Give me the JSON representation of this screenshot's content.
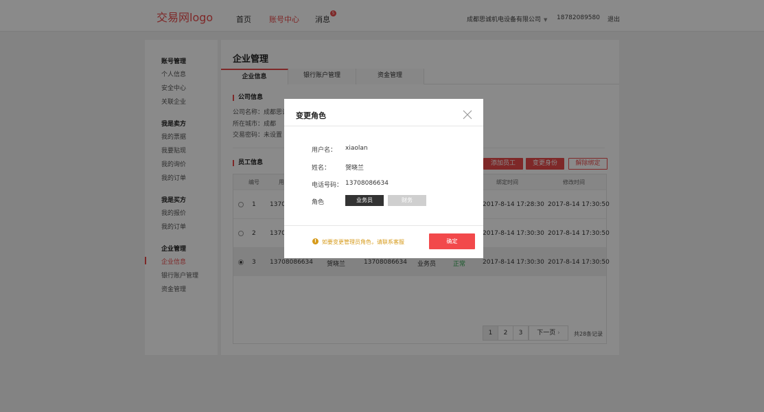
{
  "header": {
    "logo": "交易网logo",
    "nav": [
      {
        "label": "首页"
      },
      {
        "label": "账号中心"
      },
      {
        "label": "消息",
        "badge": "5"
      }
    ],
    "company": "成都思诚机电设备有限公司",
    "phone": "18782089580",
    "logout": "退出",
    "accent_color": "#e94a4a"
  },
  "sidebar": {
    "groups": [
      {
        "title": "账号管理",
        "items": [
          "个人信息",
          "安全中心",
          "关联企业"
        ]
      },
      {
        "title": "我是卖方",
        "items": [
          "我的票据",
          "我要贴现",
          "我的询价",
          "我的订单"
        ]
      },
      {
        "title": "我是买方",
        "items": [
          "我的报价",
          "我的订单"
        ]
      },
      {
        "title": "企业管理",
        "items": [
          "企业信息",
          "银行账户管理",
          "资金管理"
        ]
      }
    ]
  },
  "main": {
    "title": "企业管理",
    "tabs": [
      "企业信息",
      "银行账户管理",
      "资金管理"
    ],
    "company_section": {
      "title": "公司信息",
      "lines": [
        "公司名称：成都思诚",
        "所在城市：成都",
        "交易密码：未设置"
      ]
    },
    "staff_section": {
      "title": "员工信息",
      "buttons": {
        "add": "添加员工",
        "change": "变更身份",
        "unbind": "解除绑定"
      }
    },
    "table": {
      "headers": [
        "编号",
        "用",
        "绑定时间",
        "修改时间"
      ],
      "rows": [
        {
          "no": "1",
          "user": "1370",
          "bind_time": "2017-8-14 17:28:30",
          "edit_time": "2017-8-14 17:30:50"
        },
        {
          "no": "2",
          "user": "1370",
          "bind_time": "2017-8-14 17:30:30",
          "edit_time": "2017-8-14 17:30:50"
        },
        {
          "no": "3",
          "user": "13708086634",
          "name": "贺晓兰",
          "phone": "13708086634",
          "role": "业务员",
          "status": "正常",
          "bind_time": "2017-8-14 17:30:30",
          "edit_time": "2017-8-14 17:30:50",
          "selected": true
        }
      ]
    },
    "pager": {
      "pages": [
        "1",
        "2",
        "3"
      ],
      "next": "下一页",
      "total": "共28条记录",
      "current": "1"
    }
  },
  "modal": {
    "title": "变更角色",
    "fields": [
      {
        "label": "用户名：",
        "value": "xiaolan"
      },
      {
        "label": "姓名：",
        "value": "贺晓兰"
      },
      {
        "label": "电话号码：",
        "value": "13708086634"
      },
      {
        "label": "角色",
        "value": ""
      }
    ],
    "roles": [
      "业务员",
      "财务"
    ],
    "selected_role": "业务员",
    "notice": "如要变更管理员角色，请联系客服",
    "confirm": "确定",
    "notice_color": "#d69a1a",
    "confirm_color": "#f2494b"
  }
}
